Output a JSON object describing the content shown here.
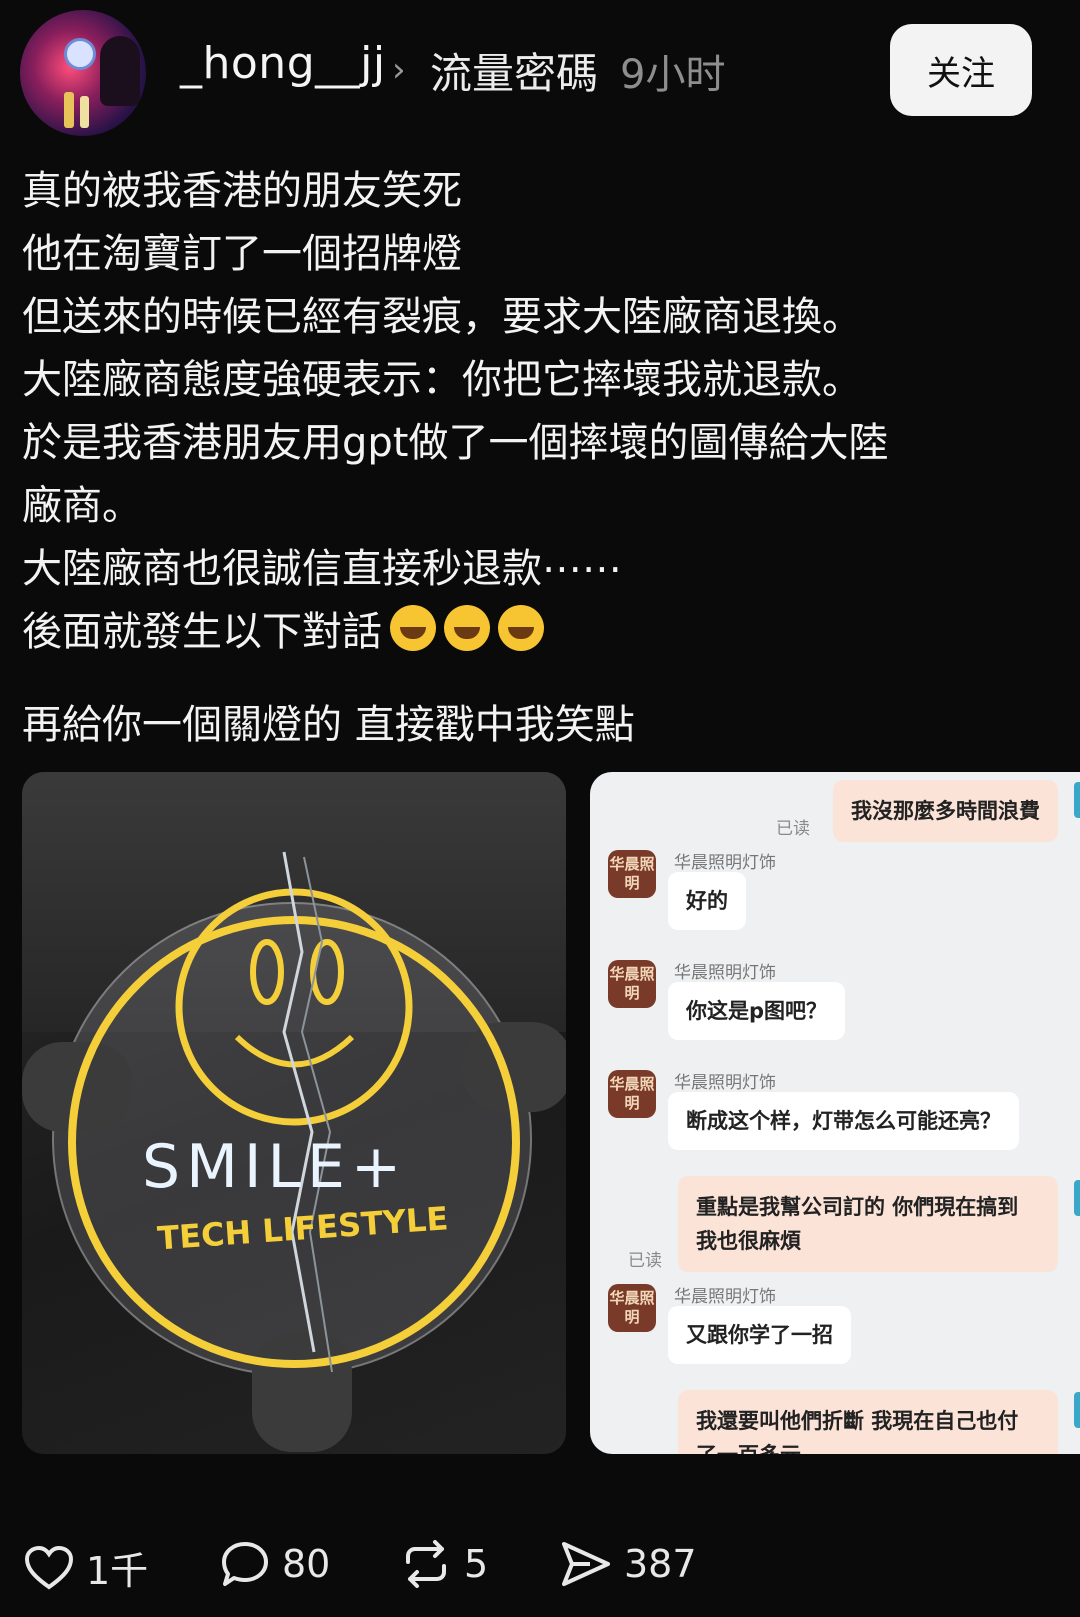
{
  "header": {
    "username": "_hong__jj",
    "topic": "流量密碼",
    "time": "9小时",
    "follow_label": "关注"
  },
  "post": {
    "lines": [
      "真的被我香港的朋友笑死",
      "他在淘寶訂了一個招牌燈",
      "但送來的時候已經有裂痕，要求大陸廠商退換。",
      "大陸廠商態度強硬表示：你把它摔壞我就退款。",
      "於是我香港朋友用gpt做了一個摔壞的圖傳給大陸",
      "廠商。",
      "大陸廠商也很誠信直接秒退款⋯⋯",
      "後面就發生以下對話"
    ],
    "second_line": "再給你一個關燈的 直接戳中我笑點"
  },
  "photo1": {
    "sign_text": "SMILE+",
    "sign_subtext": "TECH LIFESTYLE"
  },
  "chat": {
    "shop_avatar": "华晨照明",
    "shop_name": "华晨照明灯饰",
    "read_label": "已读",
    "messages": [
      {
        "side": "right",
        "text": "我沒那麼多時間浪費"
      },
      {
        "side": "left",
        "text": "好的"
      },
      {
        "side": "left",
        "text": "你这是p图吧？"
      },
      {
        "side": "left",
        "text": "断成这个样，灯带怎么可能还亮？"
      },
      {
        "side": "right",
        "text1": "重點是我幫公司訂的 你們現在搞到",
        "text2": "我也很麻煩"
      },
      {
        "side": "left",
        "text": "又跟你学了一招"
      },
      {
        "side": "right",
        "text1": "我還要叫他們折斷 我現在自己也付",
        "text2": "了一百多元"
      }
    ]
  },
  "actions": {
    "likes": "1千",
    "comments": "80",
    "reposts": "5",
    "shares": "387"
  },
  "icons": [
    "heart-icon",
    "comment-icon",
    "repost-icon",
    "share-icon",
    "chevron-right-icon"
  ]
}
